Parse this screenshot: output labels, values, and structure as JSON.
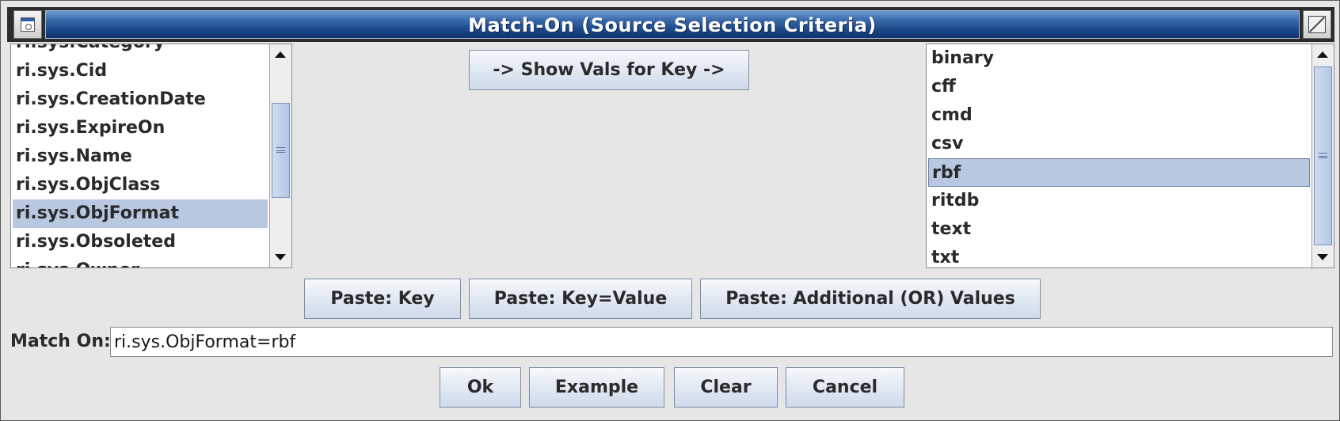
{
  "window": {
    "title": "Match-On (Source Selection Criteria)"
  },
  "keys_list": {
    "items": [
      "ri.sys.Category",
      "ri.sys.Cid",
      "ri.sys.CreationDate",
      "ri.sys.ExpireOn",
      "ri.sys.Name",
      "ri.sys.ObjClass",
      "ri.sys.ObjFormat",
      "ri.sys.Obsoleted",
      "ri.sys.Owner"
    ],
    "selected": "ri.sys.ObjFormat"
  },
  "values_list": {
    "items": [
      "binary",
      "cff",
      "cmd",
      "csv",
      "rbf",
      "ritdb",
      "text",
      "txt"
    ],
    "selected": "rbf"
  },
  "buttons": {
    "show_vals": "-> Show Vals for Key ->",
    "paste_key": "Paste: Key",
    "paste_key_value": "Paste: Key=Value",
    "paste_additional": "Paste: Additional (OR) Values",
    "ok": "Ok",
    "example": "Example",
    "clear": "Clear",
    "cancel": "Cancel"
  },
  "match_on": {
    "label": "Match On:",
    "value": "ri.sys.ObjFormat=rbf"
  },
  "colors": {
    "title_bar": "#1d4a8c",
    "selection": "#b8c8e0",
    "window_bg": "#e6e6e6"
  }
}
